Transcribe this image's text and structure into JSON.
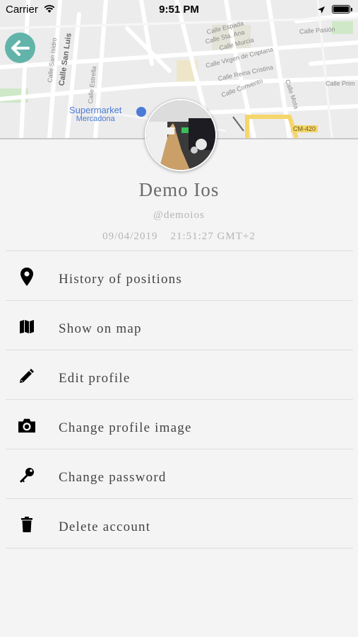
{
  "status_bar": {
    "carrier": "Carrier",
    "time": "9:51 PM"
  },
  "map": {
    "street_labels": [
      "Calle Espada",
      "Calle Sta. Ana",
      "Calle Murcia",
      "Calle Virgen de Criptana",
      "Calle Reina Cristina",
      "Calle Convento",
      "Calle Pasión",
      "Calle Prim",
      "Calle Mota",
      "Calle San Isidro",
      "Calle San Luis",
      "Calle Estrella",
      "CM-420"
    ],
    "poi": {
      "line1": "Supermarket",
      "line2": "Mercadona",
      "color": "#4c7ad8"
    }
  },
  "profile": {
    "name": "Demo Ios",
    "handle": "@demoios",
    "date": "09/04/2019",
    "time": "21:51:27 GMT+2"
  },
  "menu": [
    {
      "icon": "map-marker-icon",
      "label": "History of positions"
    },
    {
      "icon": "map-icon",
      "label": "Show on map"
    },
    {
      "icon": "pencil-icon",
      "label": "Edit profile"
    },
    {
      "icon": "camera-icon",
      "label": "Change profile image"
    },
    {
      "icon": "key-icon",
      "label": "Change password"
    },
    {
      "icon": "trash-icon",
      "label": "Delete account"
    }
  ],
  "colors": {
    "accent": "#62b4aa",
    "background": "#f4f4f4",
    "name_text": "#6a6a6a",
    "secondary_text": "#b4b4b4"
  }
}
